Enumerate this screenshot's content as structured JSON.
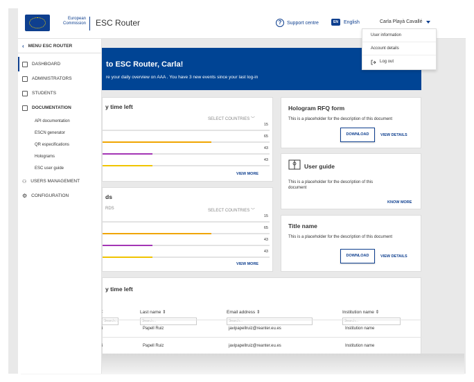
{
  "header": {
    "org_top": "European",
    "org_bottom": "Commission",
    "app_title": "ESC Router",
    "support_label": "Support centre",
    "lang_code": "EN",
    "lang_label": "English",
    "user_name": "Carla Playà Cavallé"
  },
  "user_menu": {
    "items": [
      "User information",
      "Account details",
      "Log out"
    ]
  },
  "sidebar": {
    "header": "MENU ESC ROUTER",
    "items": [
      {
        "label": "DASHBOARD"
      },
      {
        "label": "ADMINISTRATORS"
      },
      {
        "label": "STUDENTS"
      },
      {
        "label": "DOCUMENTATION"
      }
    ],
    "sub_items": [
      "API documentation",
      "ESCN generator",
      "QR especifications",
      "Holograms",
      "ESC user guide"
    ],
    "items_after": [
      {
        "label": "USERS MANAGEMENT"
      },
      {
        "label": "CONFIGURATION"
      }
    ]
  },
  "banner": {
    "title": "to ESC Router, Carla!",
    "subtitle": "re your daily overview on AAA . You have 3 new events since your last log-in"
  },
  "card_time_left": {
    "title": "y time left",
    "select_label": "SELECT COUNTRIES",
    "rows": [
      {
        "value": "15",
        "fill": 0.0,
        "color": "#e3e3e3"
      },
      {
        "value": "65",
        "fill": 0.65,
        "color": "#f0a500"
      },
      {
        "value": "43",
        "fill": 0.3,
        "color": "#a335b5"
      },
      {
        "value": "43",
        "fill": 0.3,
        "color": "#f0c400"
      }
    ],
    "view_more": "VIEW MORE"
  },
  "card_cards": {
    "title": "ds",
    "subtitle": "RDS",
    "select_label": "SELECT COUNTRIES",
    "rows": [
      {
        "value": "15",
        "fill": 0.0,
        "color": "#e3e3e3"
      },
      {
        "value": "65",
        "fill": 0.65,
        "color": "#f0a500"
      },
      {
        "value": "43",
        "fill": 0.3,
        "color": "#a335b5"
      },
      {
        "value": "43",
        "fill": 0.3,
        "color": "#f0c400"
      }
    ],
    "view_more": "VIEW MORE"
  },
  "card_hologram": {
    "title": "Hologram RFQ form",
    "desc": "This is a placeholder for the description of this document",
    "download": "DOWNLOAD",
    "details": "VIEW DETAILS"
  },
  "card_user_guide": {
    "title": "User guide",
    "desc": "This is a placeholder for the description of this document",
    "know_more": "KNOW MORE"
  },
  "card_title_name": {
    "title": "Title name",
    "desc": "This is a placeholder for the description of this document",
    "download": "DOWNLOAD",
    "details": "VIEW DETAILS"
  },
  "table": {
    "title": "y time left",
    "columns": [
      "Last name",
      "Email address",
      "Institution name"
    ],
    "search_placeholder": "Search...",
    "rows": [
      {
        "first": "i",
        "last": "Papell Ruiz",
        "email": "javipapellruiz@reanter.eu.es",
        "inst": "Institution name"
      },
      {
        "first": "i",
        "last": "Papell Ruiz",
        "email": "javipapellruiz@reanter.eu.es",
        "inst": "Institution name"
      }
    ]
  }
}
